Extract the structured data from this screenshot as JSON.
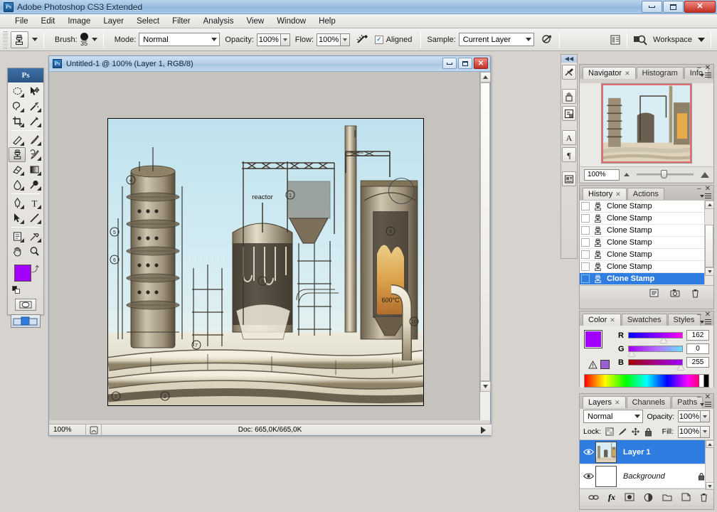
{
  "window": {
    "title": "Adobe Photoshop CS3 Extended",
    "app_icon": "Ps",
    "minimize": "minimize-icon",
    "maximize": "maximize-icon",
    "close": "✕"
  },
  "menubar": {
    "items": [
      "File",
      "Edit",
      "Image",
      "Layer",
      "Select",
      "Filter",
      "Analysis",
      "View",
      "Window",
      "Help"
    ]
  },
  "options_bar": {
    "tool_icon": "clone-stamp-icon",
    "brush_label": "Brush:",
    "brush_size": "35",
    "mode_label": "Mode:",
    "mode_value": "Normal",
    "opacity_label": "Opacity:",
    "opacity_value": "100%",
    "flow_label": "Flow:",
    "flow_value": "100%",
    "airbrush_icon": "airbrush-icon",
    "aligned_label": "Aligned",
    "aligned_checked": "✓",
    "sample_label": "Sample:",
    "sample_value": "Current Layer",
    "ignore_adjustment_icon": "ignore-adjustment-layers-icon",
    "palettes_icon": "toggle-palettes-icon",
    "bridge_icon": "go-to-bridge-icon",
    "workspace_label": "Workspace"
  },
  "toolbox": {
    "header": "Ps",
    "tools": [
      "marquee-tool",
      "move-tool",
      "lasso-tool",
      "magic-wand-tool",
      "crop-tool",
      "slice-tool",
      "healing-brush-tool",
      "brush-tool",
      "clone-stamp-tool",
      "history-brush-tool",
      "eraser-tool",
      "gradient-tool",
      "blur-tool",
      "dodge-tool",
      "pen-tool",
      "type-tool",
      "path-selection-tool",
      "line-shape-tool",
      "notes-tool",
      "eyedropper-tool",
      "hand-tool",
      "zoom-tool"
    ],
    "selected_tool": "clone-stamp-tool",
    "foreground_color": "#a200ff",
    "background_color": "#ffffff",
    "quickmask_icon": "quick-mask-icon",
    "screenmode_icon": "screen-mode-icon"
  },
  "document": {
    "title": "Untitled-1 @ 100% (Layer 1, RGB/8)",
    "status_zoom": "100%",
    "status_doc": "Doc: 665,0K/665,0K",
    "image_caption_reactor": "reactor",
    "image_caption_temp": "600°C"
  },
  "vertical_dock": {
    "items": [
      "tool-presets-icon",
      "brushes-icon",
      "clone-source-icon",
      "character-icon",
      "paragraph-icon",
      "layer-comps-icon"
    ]
  },
  "navigator_panel": {
    "tabs": [
      "Navigator",
      "Histogram",
      "Info"
    ],
    "active_tab": "Navigator",
    "zoom_value": "100%",
    "view_box_color": "#e36b72"
  },
  "history_panel": {
    "tabs": [
      "History",
      "Actions"
    ],
    "active_tab": "History",
    "states": [
      {
        "label": "Clone Stamp",
        "selected": false
      },
      {
        "label": "Clone Stamp",
        "selected": false
      },
      {
        "label": "Clone Stamp",
        "selected": false
      },
      {
        "label": "Clone Stamp",
        "selected": false
      },
      {
        "label": "Clone Stamp",
        "selected": false
      },
      {
        "label": "Clone Stamp",
        "selected": false
      },
      {
        "label": "Clone Stamp",
        "selected": true
      }
    ],
    "footer_icons": [
      "new-document-from-state-icon",
      "new-snapshot-icon",
      "delete-state-icon"
    ]
  },
  "color_panel": {
    "tabs": [
      "Color",
      "Swatches",
      "Styles"
    ],
    "active_tab": "Color",
    "foreground": "#a200ff",
    "background": "#ffffff",
    "channels": [
      {
        "label": "R",
        "value": "162",
        "pos": 63
      },
      {
        "label": "G",
        "value": "0",
        "pos": 0
      },
      {
        "label": "B",
        "value": "255",
        "pos": 100
      }
    ],
    "warning_icon": "out-of-gamut-warning-icon",
    "warning_color": "#9a5fd0"
  },
  "layers_panel": {
    "tabs": [
      "Layers",
      "Channels",
      "Paths"
    ],
    "active_tab": "Layers",
    "blend_mode": "Normal",
    "opacity_label": "Opacity:",
    "opacity_value": "100%",
    "lock_label": "Lock:",
    "lock_icons": [
      "lock-transparent-pixels-icon",
      "lock-image-pixels-icon",
      "lock-position-icon",
      "lock-all-icon"
    ],
    "fill_label": "Fill:",
    "fill_value": "100%",
    "layers": [
      {
        "name": "Layer 1",
        "selected": true,
        "visible": true,
        "locked": false
      },
      {
        "name": "Background",
        "selected": false,
        "visible": true,
        "locked": true
      }
    ],
    "footer_icons": [
      "link-layers-icon",
      "layer-style-icon",
      "layer-mask-icon",
      "adjustment-layer-icon",
      "new-group-icon",
      "new-layer-icon",
      "delete-layer-icon"
    ],
    "layer_style_label": "fx"
  }
}
